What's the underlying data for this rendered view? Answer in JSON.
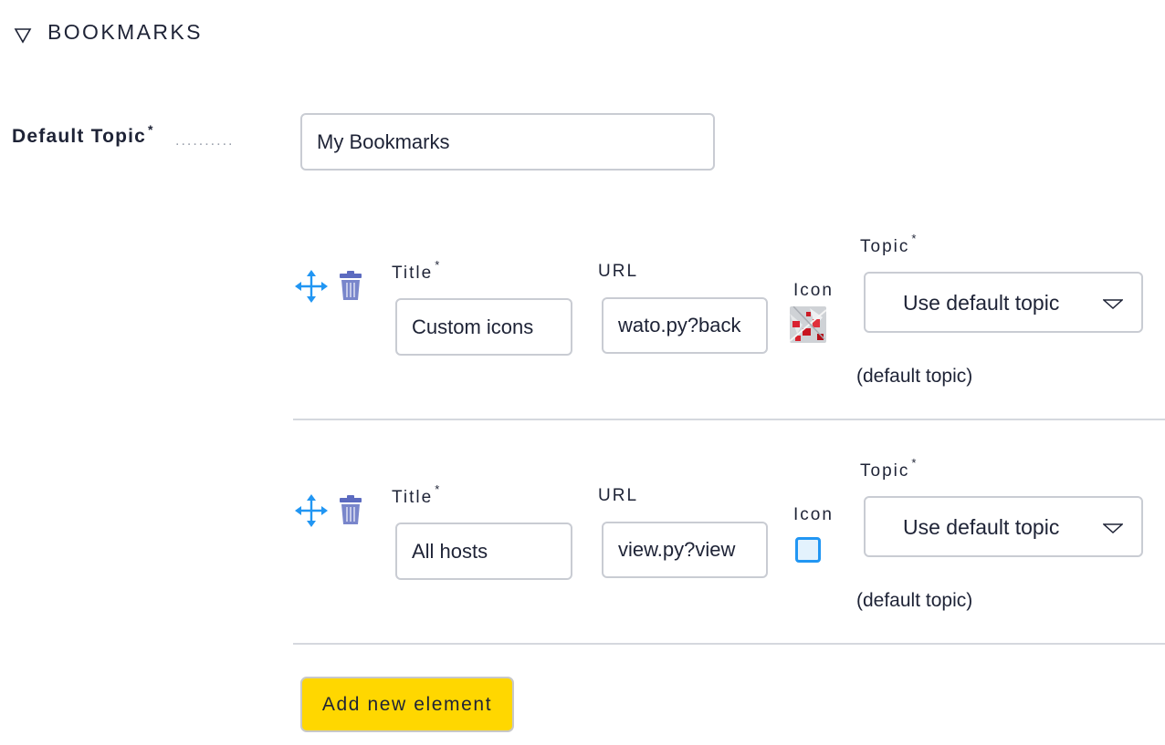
{
  "section": {
    "title": "BOOKMARKS"
  },
  "default_topic": {
    "label": "Default Topic",
    "required_mark": "*",
    "value": "My Bookmarks"
  },
  "bookmarks": [
    {
      "title_label": "Title",
      "title_required": "*",
      "title_value": "Custom icons",
      "url_label": "URL",
      "url_value": "wato.py?back",
      "icon_label": "Icon",
      "topic_label": "Topic",
      "topic_required": "*",
      "topic_value": "Use default topic",
      "topic_note": "(default topic)"
    },
    {
      "title_label": "Title",
      "title_required": "*",
      "title_value": "All hosts",
      "url_label": "URL",
      "url_value": "view.py?view",
      "icon_label": "Icon",
      "topic_label": "Topic",
      "topic_required": "*",
      "topic_value": "Use default topic",
      "topic_note": "(default topic)"
    }
  ],
  "add_button": {
    "label": "Add new element"
  },
  "colors": {
    "accent": "#2196f3",
    "button": "#ffd700",
    "trash": "#5c6bc0",
    "text": "#1e2336"
  }
}
